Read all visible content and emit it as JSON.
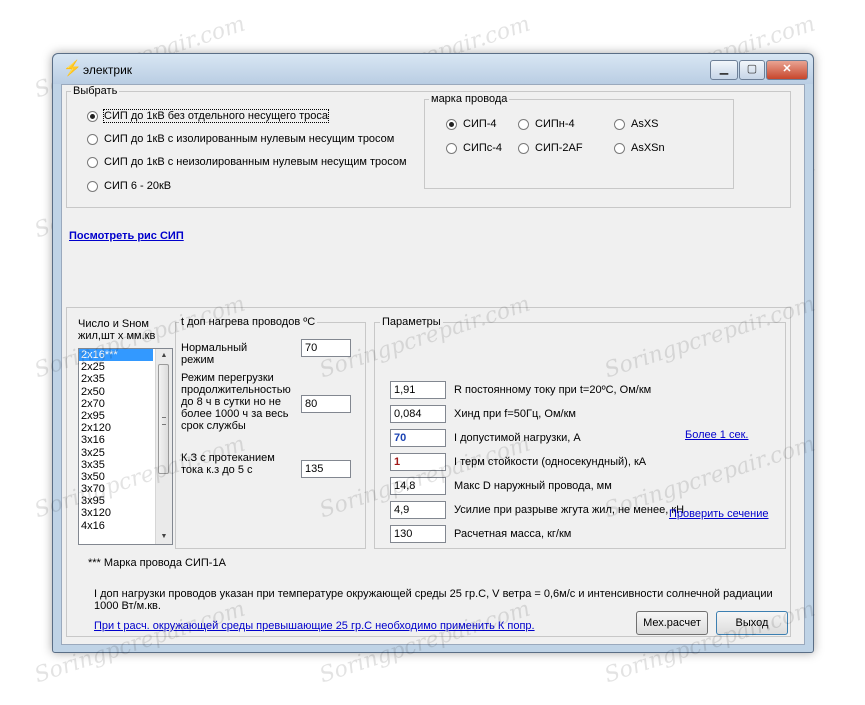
{
  "window": {
    "title": "электрик",
    "icon": "lightning-icon"
  },
  "select_group": {
    "label": "Выбрать",
    "options": [
      "СИП до 1кВ без отдельного несущего троса",
      "СИП до 1кВ с изолированным нулевым несущим тросом",
      "СИП до 1кВ с неизолированным нулевым несущим тросом",
      "СИП 6 - 20кВ"
    ],
    "selected": 0
  },
  "wire_brand": {
    "label": "марка провода",
    "options": [
      "СИП-4",
      "СИПн-4",
      "AsXS",
      "СИПс-4",
      "СИП-2AF",
      "AsXSn"
    ],
    "selected": 0
  },
  "view_link": "Посмотреть рис СИП",
  "count_section": {
    "label_line1": "Число и Sном",
    "label_line2": "жил,шт х мм.кв",
    "items": [
      "2x16***",
      "2x25",
      "2x35",
      "2x50",
      "2x70",
      "2x95",
      "2x120",
      "3x16",
      "3x25",
      "3x35",
      "3x50",
      "3x70",
      "3x95",
      "3x120",
      "4x16"
    ],
    "selected": 0,
    "footnote": "*** Марка провода СИП-1А"
  },
  "temp_section": {
    "title": "t доп нагрева проводов ºС",
    "normal_label": [
      "Нормальный",
      "режим"
    ],
    "normal_value": "70",
    "overload_label": [
      "Режим перегрузки",
      "продолжительностью",
      "до 8 ч в сутки но не",
      "более 1000 ч за весь",
      "срок службы"
    ],
    "overload_value": "80",
    "short_label": [
      "К.З с протеканием",
      "тока к.з до 5 с"
    ],
    "short_value": "135"
  },
  "params": {
    "label": "Параметры",
    "rows": [
      {
        "value": "1,91",
        "label": "R постоянному току при t=20ºС, Ом/км"
      },
      {
        "value": "0,084",
        "label": "Xинд при f=50Гц, Ом/км"
      },
      {
        "value": "70",
        "label": "I допустимой нагрузки, А"
      },
      {
        "value": "1",
        "label": "I терм  стойкости (односекундный), кА"
      },
      {
        "value": "14,8",
        "label": "Макс D наружный провода, мм"
      },
      {
        "value": "4,9",
        "label": "Усилие при разрыве жгута жил, не менее, кН"
      },
      {
        "value": "130",
        "label": "Расчетная масса, кг/км"
      }
    ],
    "more_link": "Более 1 сек.",
    "check_link": "Проверить сечение"
  },
  "note": {
    "line1": "I доп нагрузки проводов указан при температуре окружающей среды 25 гр.С, V ветра = 0,6м/с  и интенсивности солнечной радиации",
    "line2": "1000 Вт/м.кв.",
    "link": "При t расч. окружающей среды превышающие 25 гр.С необходимо применить К попр."
  },
  "buttons": {
    "mech": "Мех.расчет",
    "exit": "Выход"
  },
  "watermark": "Soringpcrepair.com"
}
